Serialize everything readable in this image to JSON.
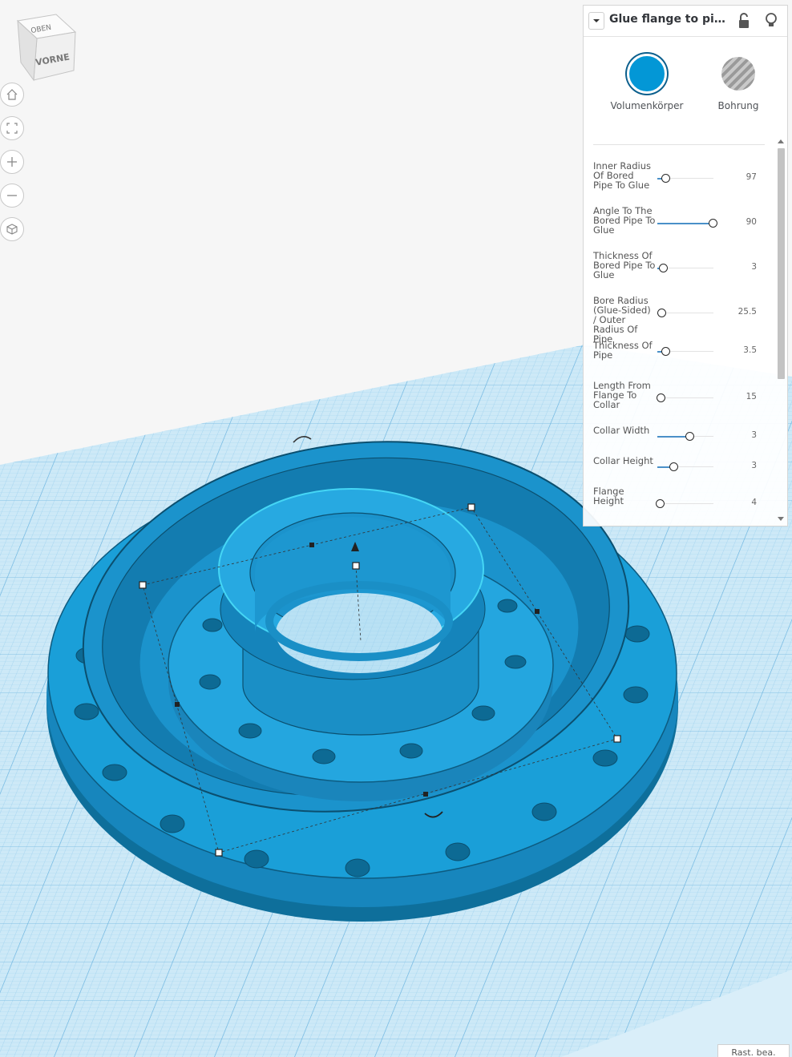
{
  "view_cube": {
    "top_label": "OBEN",
    "front_label": "VORNE"
  },
  "navigation": [
    {
      "name": "home-view-button",
      "icon": "home-icon"
    },
    {
      "name": "fit-view-button",
      "icon": "fit-frame-icon"
    },
    {
      "name": "zoom-in-button",
      "icon": "plus-icon"
    },
    {
      "name": "zoom-out-button",
      "icon": "minus-icon"
    },
    {
      "name": "perspective-button",
      "icon": "cube-view-icon"
    }
  ],
  "inspector": {
    "title": "Glue flange to pipe ...",
    "lock_icon": "unlock-icon",
    "bulb_icon": "lightbulb-icon",
    "dropdown_icon": "chevron-down-icon",
    "types": [
      {
        "label": "Volumenkörper",
        "selected": true,
        "color": "#0397d6"
      },
      {
        "label": "Bohrung",
        "selected": false,
        "color": "#9a9a9a"
      }
    ],
    "params": [
      {
        "label": "Inner Radius Of Bored Pipe To Glue",
        "value": "97",
        "fill": 0.14
      },
      {
        "label": "Angle To The Bored Pipe To Glue",
        "value": "90",
        "fill": 0.98
      },
      {
        "label": "Thickness Of Bored Pipe To Glue",
        "value": "3",
        "fill": 0.1
      },
      {
        "label": "Bore Radius (Glue-Sided) / Outer Radius Of Pipe",
        "value": "25.5",
        "fill": 0.07
      },
      {
        "label": "Thickness Of Pipe",
        "value": "3.5",
        "fill": 0.14
      },
      {
        "label": "Length From Flange To Collar",
        "value": "15",
        "fill": 0.05
      },
      {
        "label": "Collar Width",
        "value": "3",
        "fill": 0.57
      },
      {
        "label": "Collar Height",
        "value": "3",
        "fill": 0.28
      },
      {
        "label": "Flange Height",
        "value": "4",
        "fill": 0.04
      }
    ]
  },
  "grid_button": {
    "label": "Rast. bea."
  },
  "colors": {
    "accent": "#0397d6",
    "grid_bg": "#c5e4f5",
    "grid_line": "#8ec8e8",
    "shape": "#1a9fd8"
  }
}
